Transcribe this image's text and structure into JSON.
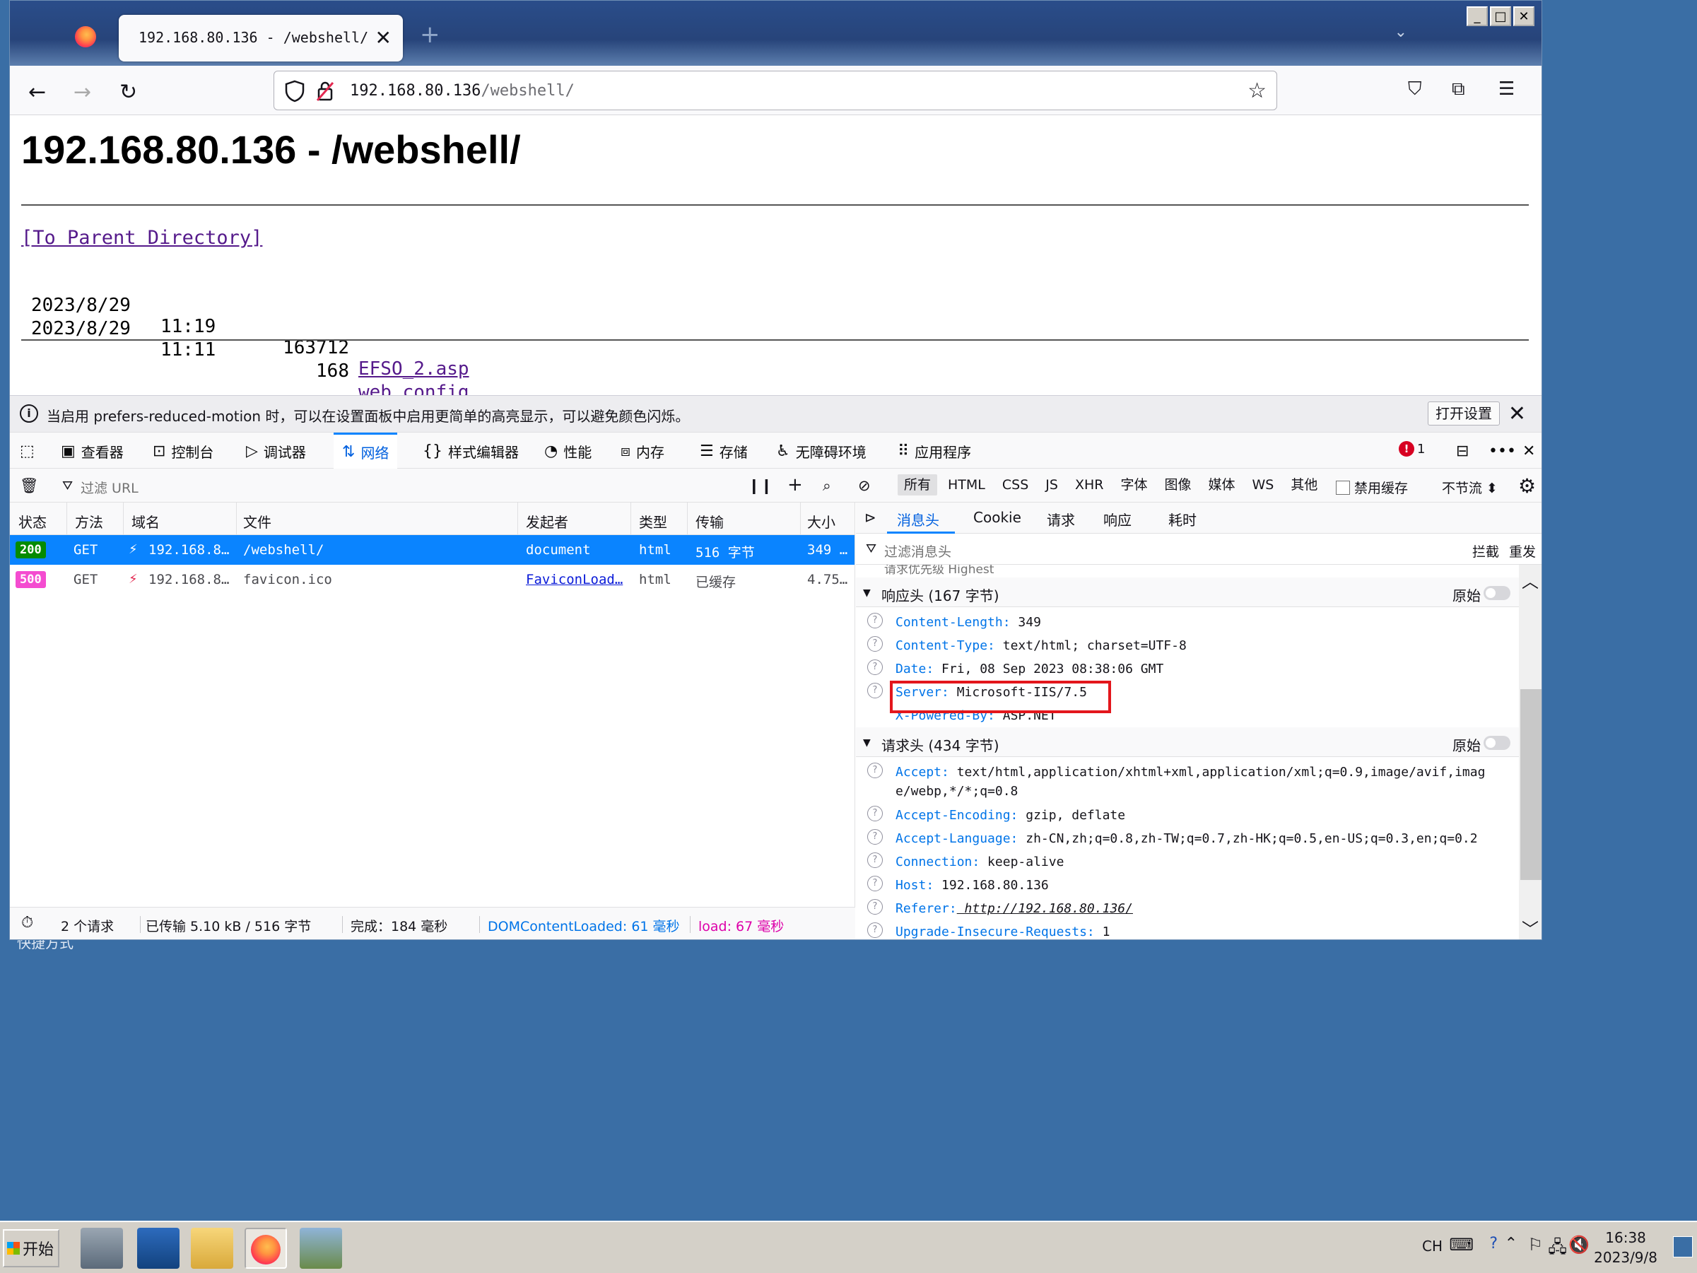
{
  "desktop": {
    "label": "快捷方式"
  },
  "browser": {
    "tab_title": "192.168.80.136 - /webshell/",
    "url_host": "192.168.80.136",
    "url_path": "/webshell/"
  },
  "page": {
    "title": "192.168.80.136 - /webshell/",
    "parent_link": "[To Parent Directory]",
    "files": [
      {
        "date": "2023/8/29",
        "time": "11:19",
        "size": "163712",
        "name": "EFSO_2.asp"
      },
      {
        "date": "2023/8/29",
        "time": "11:11",
        "size": "168",
        "name": "web.config"
      }
    ]
  },
  "notification": {
    "text": "当启用 prefers-reduced-motion 时，可以在设置面板中启用更简单的高亮显示，可以避免颜色闪烁。",
    "button": "打开设置"
  },
  "devtools": {
    "tabs": [
      {
        "label": "查看器",
        "icon": "inspector-icon"
      },
      {
        "label": "控制台",
        "icon": "console-icon"
      },
      {
        "label": "调试器",
        "icon": "debugger-icon"
      },
      {
        "label": "网络",
        "icon": "network-icon"
      },
      {
        "label": "样式编辑器",
        "icon": "style-editor-icon"
      },
      {
        "label": "性能",
        "icon": "performance-icon"
      },
      {
        "label": "内存",
        "icon": "memory-icon"
      },
      {
        "label": "存储",
        "icon": "storage-icon"
      },
      {
        "label": "无障碍环境",
        "icon": "accessibility-icon"
      },
      {
        "label": "应用程序",
        "icon": "application-icon"
      }
    ],
    "error_count": "1",
    "filter_placeholder": "过滤 URL",
    "type_filters": [
      "所有",
      "HTML",
      "CSS",
      "JS",
      "XHR",
      "字体",
      "图像",
      "媒体",
      "WS",
      "其他"
    ],
    "disable_cache": "禁用缓存",
    "throttle": "不节流 ⬍",
    "columns": [
      "状态",
      "方法",
      "域名",
      "文件",
      "发起者",
      "类型",
      "传输",
      "大小"
    ],
    "requests": [
      {
        "status": "200",
        "method": "GET",
        "domain": "192.168.8…",
        "file": "/webshell/",
        "initiator": "document",
        "type": "html",
        "transfer": "516 字节",
        "size": "349 …"
      },
      {
        "status": "500",
        "method": "GET",
        "domain": "192.168.8…",
        "file": "favicon.ico",
        "initiator": "FaviconLoad…",
        "type": "html",
        "transfer": "已缓存",
        "size": "4.75…"
      }
    ],
    "footer": {
      "count": "2 个请求",
      "transferred": "已传输 5.10 kB / 516 字节",
      "finish": "完成：184 毫秒",
      "dcl": "DOMContentLoaded: 61 毫秒",
      "load": "load: 67 毫秒"
    },
    "detail_tabs": [
      "消息头",
      "Cookie",
      "请求",
      "响应",
      "耗时"
    ],
    "detail_filter": "过滤消息头",
    "block": "拦截",
    "resend": "重发",
    "cut_row": "请求优先级   Highest",
    "response_section": "响应头 (167 字节)",
    "request_section": "请求头 (434 字节)",
    "raw": "原始",
    "response_headers": [
      {
        "k": "Content-Length:",
        "v": " 349",
        "q": true
      },
      {
        "k": "Content-Type:",
        "v": " text/html; charset=UTF-8",
        "q": true
      },
      {
        "k": "Date:",
        "v": " Fri, 08 Sep 2023 08:38:06 GMT",
        "q": true
      },
      {
        "k": "Server:",
        "v": " Microsoft-IIS/7.5",
        "q": true
      },
      {
        "k": "X-Powered-By:",
        "v": " ASP.NET",
        "q": false
      }
    ],
    "request_headers": [
      {
        "k": "Accept:",
        "v": " text/html,application/xhtml+xml,application/xml;q=0.9,image/avif,image/webp,*/*;q=0.8"
      },
      {
        "k": "Accept-Encoding:",
        "v": " gzip, deflate"
      },
      {
        "k": "Accept-Language:",
        "v": " zh-CN,zh;q=0.8,zh-TW;q=0.7,zh-HK;q=0.5,en-US;q=0.3,en;q=0.2"
      },
      {
        "k": "Connection:",
        "v": " keep-alive"
      },
      {
        "k": "Host:",
        "v": " 192.168.80.136"
      },
      {
        "k": "Referer:",
        "v": " http://192.168.80.136/"
      },
      {
        "k": "Upgrade-Insecure-Requests:",
        "v": " 1"
      }
    ]
  },
  "taskbar": {
    "start": "开始",
    "lang": "CH",
    "time": "16:38",
    "date": "2023/9/8"
  }
}
